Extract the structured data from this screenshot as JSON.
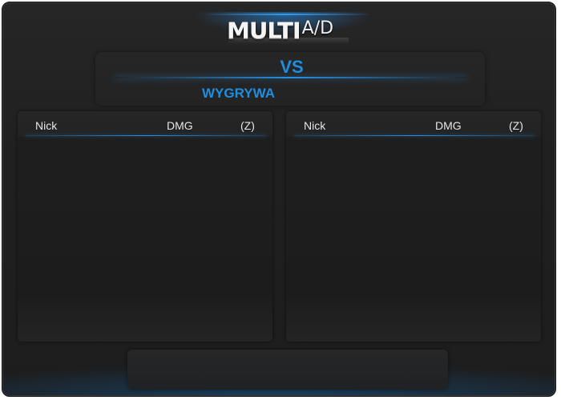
{
  "title": {
    "main": "MULTI",
    "sub": "A/D"
  },
  "score": {
    "vs_label": "VS",
    "winner_label": "WYGRYWA"
  },
  "teams": [
    {
      "columns": {
        "nick": "Nick",
        "dmg": "DMG",
        "z": "(Z)"
      },
      "rows": []
    },
    {
      "columns": {
        "nick": "Nick",
        "dmg": "DMG",
        "z": "(Z)"
      },
      "rows": []
    }
  ],
  "colors": {
    "accent": "#1f8de0",
    "background": "#1e1e1e",
    "panel": "#232323",
    "text": "#e6e6e6"
  }
}
